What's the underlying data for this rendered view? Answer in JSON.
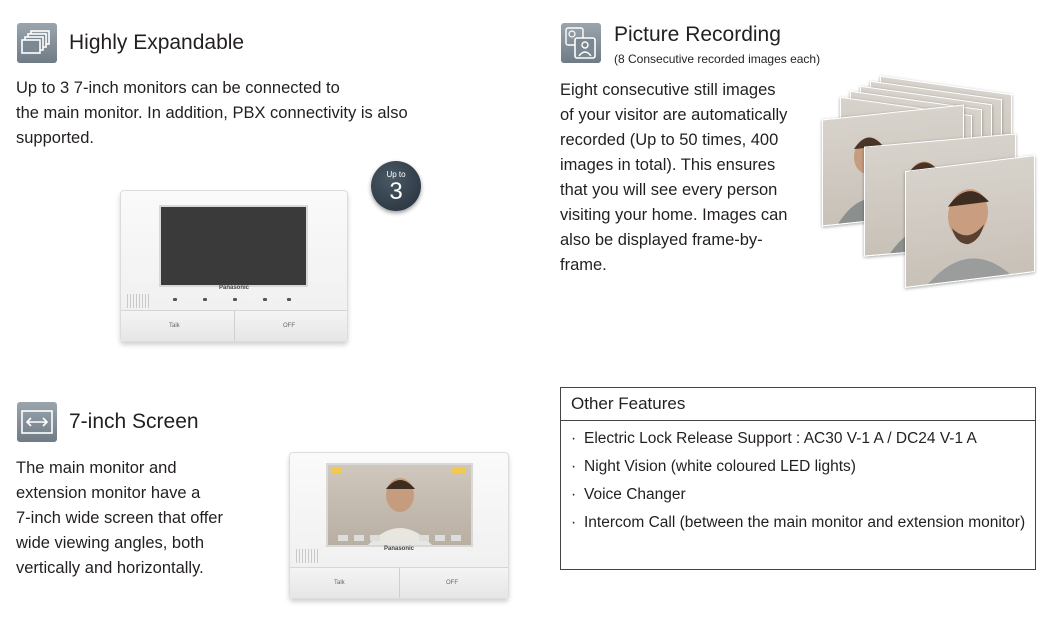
{
  "sections": {
    "expandable": {
      "icon": "stacked-monitors-icon",
      "title": "Highly Expandable",
      "lines": [
        "Up to 3 7-inch monitors can be connected to",
        "the main monitor. In addition, PBX connectivity is also",
        "supported."
      ],
      "badge_small": "Up to",
      "badge_big": "3"
    },
    "recording": {
      "icon": "picture-frames-icon",
      "title": "Picture Recording",
      "subtitle": "(8 Consecutive recorded images each)",
      "lines": [
        "Eight consecutive still images",
        "of your visitor are automatically",
        "recorded (Up to 50 times, 400",
        "images in total). This ensures",
        "that you will see every person",
        "visiting your home. Images can",
        "also be displayed frame-by-",
        "frame."
      ]
    },
    "screen": {
      "icon": "horizontal-arrows-icon",
      "title": "7-inch Screen",
      "lines": [
        "The main monitor and",
        "extension monitor have a",
        "7-inch wide screen that offer",
        "wide viewing angles, both",
        "vertically and horizontally."
      ]
    }
  },
  "monitor": {
    "brand": "Panasonic",
    "left_button": "Talk",
    "right_button": "OFF"
  },
  "other_features": {
    "title": "Other Features",
    "bullet": "·",
    "items": [
      "Electric Lock Release Support : AC30 V-1 A / DC24 V-1 A",
      "Night Vision (white coloured LED lights)",
      "Voice Changer",
      "Intercom Call (between the main monitor and extension monitor)"
    ]
  }
}
